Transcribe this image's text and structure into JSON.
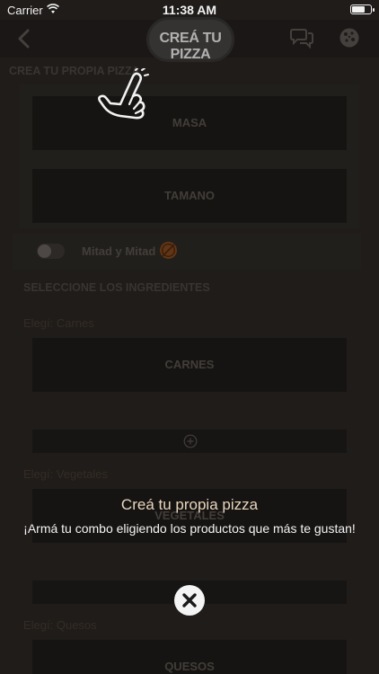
{
  "status_bar": {
    "carrier": "Carrier",
    "time": "11:38 AM"
  },
  "nav": {
    "title": "CREÁ TU PIZZA",
    "back_icon": "chevron-left-icon",
    "chat_icon": "chat-bubbles-icon",
    "pizza_icon": "pizza-icon"
  },
  "builder": {
    "section_title": "CREA TU PROPIA PIZZA",
    "masa_label": "MASA",
    "tamano_label": "TAMANO",
    "half_label": "Mitad y Mitad",
    "ingredients_title": "SELECCIONE LOS INGREDIENTES",
    "groups": [
      {
        "prompt": "Elegí: Carnes",
        "button": "CARNES"
      },
      {
        "prompt": "Elegí: Vegetales",
        "button": "VEGETALES"
      },
      {
        "prompt": "Elegí: Quesos",
        "button": "QUESOS"
      }
    ]
  },
  "promo": {
    "title": "Creá tu propia pizza",
    "subtitle": "¡Armá tu combo eligiendo los productos que más te gustan!"
  },
  "colors": {
    "background": "#2b2724",
    "accent_gold": "#e9d6bd",
    "accent_orange": "#8a4a1e"
  }
}
